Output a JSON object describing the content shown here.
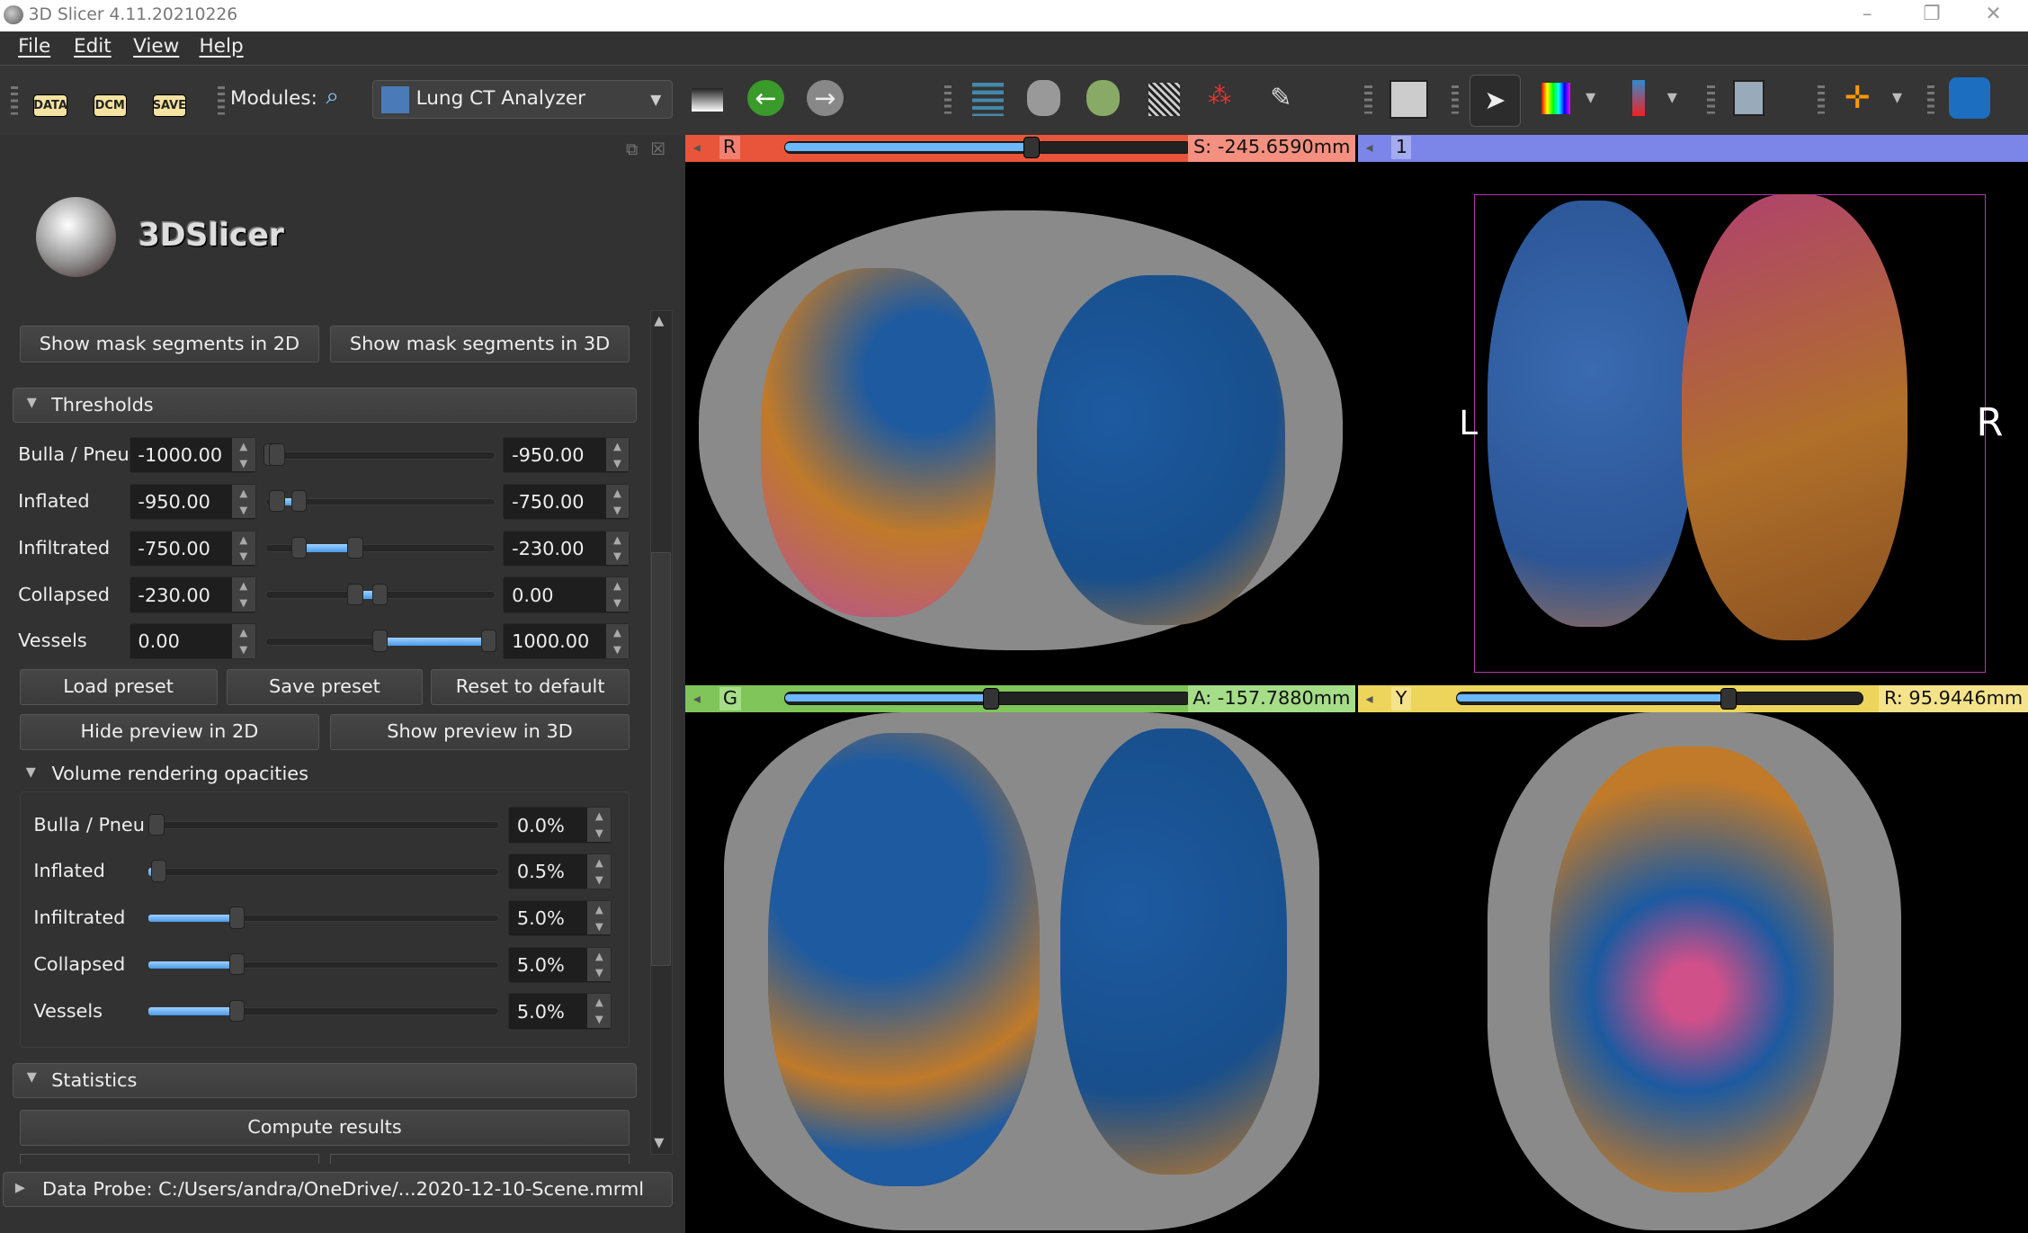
{
  "window": {
    "title": "3D Slicer 4.11.20210226",
    "controls": [
      "–",
      "❐",
      "✕"
    ]
  },
  "menu": [
    "File",
    "Edit",
    "View",
    "Help"
  ],
  "toolbar": {
    "data_label": "DATA",
    "dcm_label": "DCM",
    "save_label": "SAVE",
    "modules_label": "Modules:",
    "module_selected": "Lung CT Analyzer",
    "icons": [
      "search-icon",
      "layout-icon",
      "back-arrow-icon",
      "forward-arrow-icon",
      "data-tree-icon",
      "volumes-icon",
      "volume-rendering-icon",
      "models-icon",
      "markups-icon",
      "segment-editor-icon",
      "view-layout-icon",
      "mouse-pointer-icon",
      "colors-icon",
      "fiducial-place-icon",
      "screenshot-icon",
      "crosshair-icon",
      "extensions-icon"
    ]
  },
  "panel": {
    "logo_text": "3DSlicer",
    "mask_buttons": [
      "Show mask segments in 2D",
      "Show mask segments in 3D"
    ],
    "thresholds": {
      "title": "Thresholds",
      "range": [
        -1000,
        1000
      ],
      "rows": [
        {
          "label": "Bulla / Pneu",
          "min": "-1000.00",
          "max": "-950.00",
          "lo": -1000,
          "hi": -950
        },
        {
          "label": "Inflated",
          "min": "-950.00",
          "max": "-750.00",
          "lo": -950,
          "hi": -750
        },
        {
          "label": "Infiltrated",
          "min": "-750.00",
          "max": "-230.00",
          "lo": -750,
          "hi": -230
        },
        {
          "label": "Collapsed",
          "min": "-230.00",
          "max": "0.00",
          "lo": -230,
          "hi": 0
        },
        {
          "label": "Vessels",
          "min": "0.00",
          "max": "1000.00",
          "lo": 0,
          "hi": 1000
        }
      ]
    },
    "preset_buttons": [
      "Load preset",
      "Save preset",
      "Reset to default"
    ],
    "preview_buttons": [
      "Hide preview in 2D",
      "Show preview in 3D"
    ],
    "opacities": {
      "title": "Volume rendering opacities",
      "max_percent": 20,
      "rows": [
        {
          "label": "Bulla / Pneu",
          "value": "0.0%",
          "percent": 0
        },
        {
          "label": "Inflated",
          "value": "0.5%",
          "percent": 0.5
        },
        {
          "label": "Infiltrated",
          "value": "5.0%",
          "percent": 5
        },
        {
          "label": "Collapsed",
          "value": "5.0%",
          "percent": 5
        },
        {
          "label": "Vessels",
          "value": "5.0%",
          "percent": 5
        }
      ]
    },
    "statistics": {
      "title": "Statistics",
      "compute_label": "Compute results"
    },
    "data_probe": "Data Probe: C:/Users/andra/OneDrive/...2020-12-10-Scene.mrml"
  },
  "views": {
    "red": {
      "name": "R",
      "offset": "S: -245.6590mm",
      "slider_fraction": 0.61,
      "color": "#e8553a"
    },
    "threed": {
      "name": "1",
      "left_label": "L",
      "right_label": "R",
      "color": "#7b86e8"
    },
    "green": {
      "name": "G",
      "offset": "A: -157.7880mm",
      "slider_fraction": 0.51,
      "color": "#7fc55a"
    },
    "yellow": {
      "name": "Y",
      "offset": "R: 95.9446mm",
      "slider_fraction": 0.67,
      "color": "#ecd55a"
    }
  }
}
